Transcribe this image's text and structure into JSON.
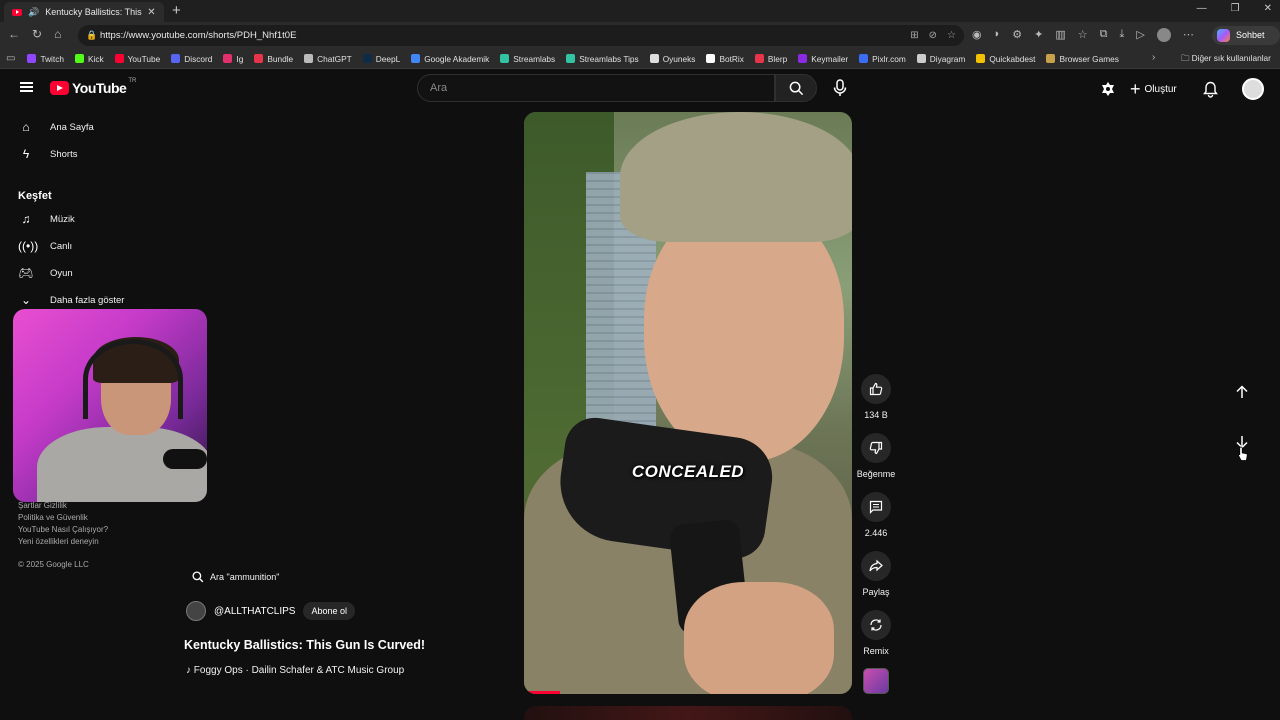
{
  "browser": {
    "tab_title": "Kentucky Ballistics: This Gun",
    "url": "https://www.youtube.com/shorts/PDH_Nhf1t0E",
    "copilot_label": "Sohbet et",
    "bookmarks": [
      {
        "label": "Twitch",
        "color": "#9146ff"
      },
      {
        "label": "Kick",
        "color": "#53fc18"
      },
      {
        "label": "YouTube",
        "color": "#ff0033"
      },
      {
        "label": "Discord",
        "color": "#5865f2"
      },
      {
        "label": "Ig",
        "color": "#e1306c"
      },
      {
        "label": "Bundle",
        "color": "#e8344b"
      },
      {
        "label": "ChatGPT",
        "color": "#bbbbbb"
      },
      {
        "label": "DeepL",
        "color": "#0f2b46"
      },
      {
        "label": "Google Akademik",
        "color": "#4285f4"
      },
      {
        "label": "Streamlabs",
        "color": "#31c3a2"
      },
      {
        "label": "Streamlabs Tips",
        "color": "#31c3a2"
      },
      {
        "label": "Oyuneks",
        "color": "#dddddd"
      },
      {
        "label": "BotRix",
        "color": "#ffffff"
      },
      {
        "label": "Blerp",
        "color": "#e8344b"
      },
      {
        "label": "Keymailer",
        "color": "#8a2be2"
      },
      {
        "label": "Pixlr.com",
        "color": "#3a6cf4"
      },
      {
        "label": "Diyagram",
        "color": "#cccccc"
      },
      {
        "label": "Quickabdest",
        "color": "#f2c200"
      },
      {
        "label": "Browser Games",
        "color": "#c8a24a"
      }
    ],
    "other_bookmarks": "Diğer sık kullanılanlar"
  },
  "youtube": {
    "region": "TR",
    "logo_text": "YouTube",
    "search_placeholder": "Ara",
    "create_label": "Oluştur",
    "sidebar": {
      "home": "Ana Sayfa",
      "shorts": "Shorts",
      "explore_heading": "Keşfet",
      "music": "Müzik",
      "live": "Canlı",
      "gaming": "Oyun",
      "show_more": "Daha fazla göster",
      "footer_links_1": "Şartlar   Gizlilik",
      "footer_links_2": "Politika ve Güvenlik",
      "footer_links_3": "YouTube Nasıl Çalışıyor?",
      "footer_links_4": "Yeni özellikleri deneyin",
      "copyright": "© 2025 Google LLC"
    },
    "short": {
      "caption": "CONCEALED",
      "search_suggestion": "Ara \"ammunition\"",
      "channel": "@ALLTHATCLIPS",
      "subscribe_label": "Abone ol",
      "title": "Kentucky Ballistics: This Gun Is Curved!",
      "music": "Foggy Ops · Dailin Schafer & ATC Music Group",
      "likes": "134 B",
      "dislike_label": "Beğenme",
      "comments": "2.446",
      "share_label": "Paylaş",
      "remix_label": "Remix"
    }
  }
}
